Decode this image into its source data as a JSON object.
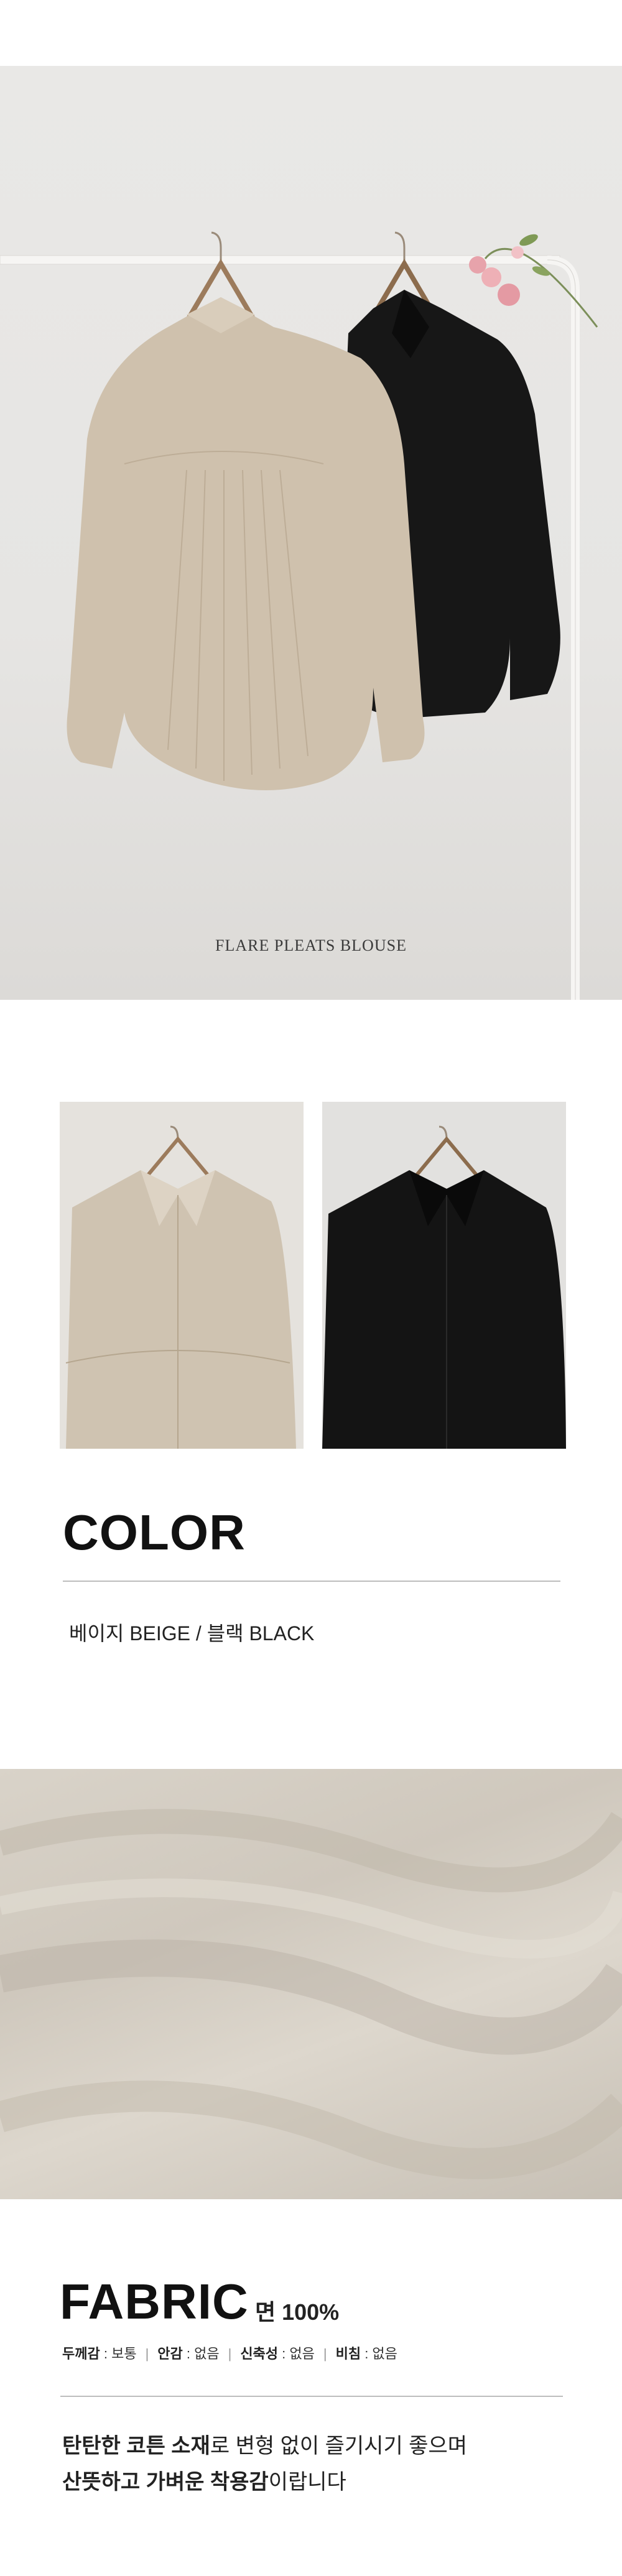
{
  "hero": {
    "caption": "FLARE PLEATS BLOUSE",
    "colors": {
      "background": "#e7e6e4",
      "rack": "#f4f3f1",
      "beige": "#cfc1ad",
      "black": "#161616",
      "flowers": "#e7a3ab"
    }
  },
  "color_section": {
    "title": "COLOR",
    "value": "베이지 BEIGE / 블랙 BLACK"
  },
  "fabric_section": {
    "title": "FABRIC",
    "composition": "면 100%",
    "specs": [
      {
        "key": "두께감",
        "value": "보통"
      },
      {
        "key": "안감",
        "value": "없음"
      },
      {
        "key": "신축성",
        "value": "없음"
      },
      {
        "key": "비침",
        "value": "없음"
      }
    ],
    "description_line1_bold": "탄탄한 코튼 소재",
    "description_line1_rest": "로 변형 없이 즐기시기 좋으며",
    "description_line2_bold": "산뜻하고 가벼운 착용감",
    "description_line2_rest": "이랍니다"
  }
}
